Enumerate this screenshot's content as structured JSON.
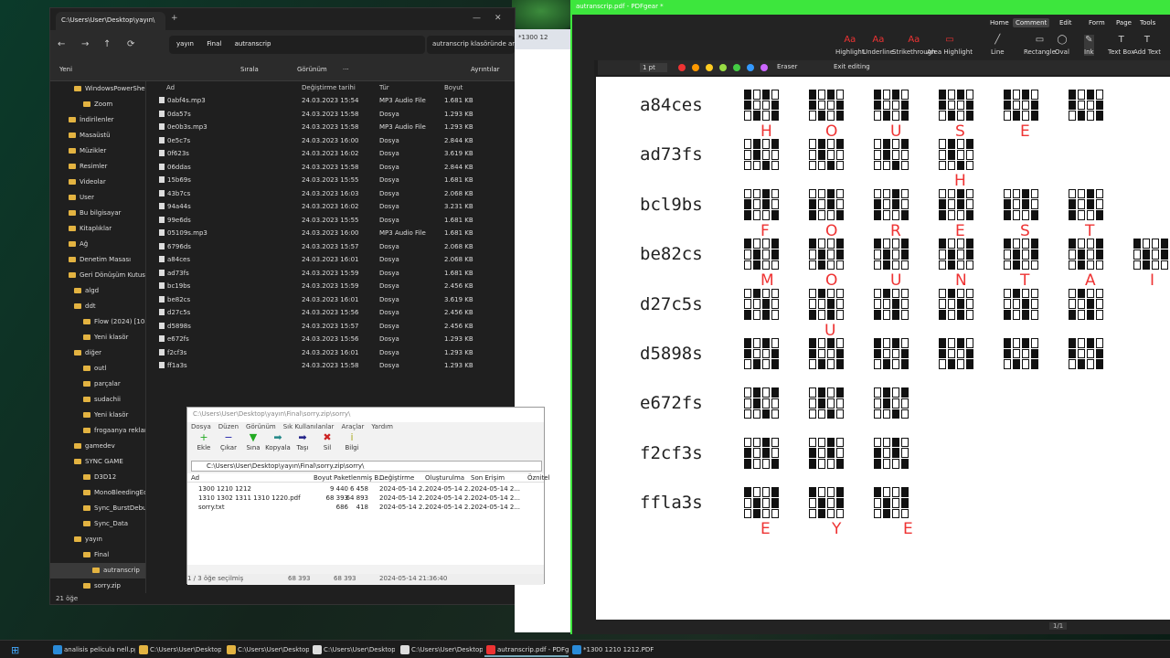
{
  "explorer": {
    "tab_title": "C:\\Users\\User\\Desktop\\yayın\\",
    "breadcrumb": [
      "yayın",
      "Final",
      "autranscrip"
    ],
    "search_placeholder": "autranscrip klasöründe ar..",
    "cmd": {
      "new": "Yeni",
      "sort": "Sırala",
      "view": "Görünüm",
      "more": "···",
      "details": "Ayrıntılar"
    },
    "columns": {
      "name": "Ad",
      "date": "Değiştirme tarihi",
      "type": "Tür",
      "size": "Boyut"
    },
    "files": [
      {
        "name": "0abf4s.mp3",
        "date": "24.03.2023 15:54",
        "type": "MP3 Audio File",
        "size": "1.681 KB"
      },
      {
        "name": "0da57s",
        "date": "24.03.2023 15:58",
        "type": "Dosya",
        "size": "1.293 KB"
      },
      {
        "name": "0e0b3s.mp3",
        "date": "24.03.2023 15:58",
        "type": "MP3 Audio File",
        "size": "1.293 KB"
      },
      {
        "name": "0e5c7s",
        "date": "24.03.2023 16:00",
        "type": "Dosya",
        "size": "2.844 KB"
      },
      {
        "name": "0f623s",
        "date": "24.03.2023 16:02",
        "type": "Dosya",
        "size": "3.619 KB"
      },
      {
        "name": "06ddas",
        "date": "24.03.2023 15:58",
        "type": "Dosya",
        "size": "2.844 KB"
      },
      {
        "name": "15b69s",
        "date": "24.03.2023 15:55",
        "type": "Dosya",
        "size": "1.681 KB"
      },
      {
        "name": "43b7cs",
        "date": "24.03.2023 16:03",
        "type": "Dosya",
        "size": "2.068 KB"
      },
      {
        "name": "94a44s",
        "date": "24.03.2023 16:02",
        "type": "Dosya",
        "size": "3.231 KB"
      },
      {
        "name": "99e6ds",
        "date": "24.03.2023 15:55",
        "type": "Dosya",
        "size": "1.681 KB"
      },
      {
        "name": "05109s.mp3",
        "date": "24.03.2023 16:00",
        "type": "MP3 Audio File",
        "size": "1.681 KB"
      },
      {
        "name": "6796ds",
        "date": "24.03.2023 15:57",
        "type": "Dosya",
        "size": "2.068 KB"
      },
      {
        "name": "a84ces",
        "date": "24.03.2023 16:01",
        "type": "Dosya",
        "size": "2.068 KB"
      },
      {
        "name": "ad73fs",
        "date": "24.03.2023 15:59",
        "type": "Dosya",
        "size": "1.681 KB"
      },
      {
        "name": "bc19bs",
        "date": "24.03.2023 15:59",
        "type": "Dosya",
        "size": "2.456 KB"
      },
      {
        "name": "be82cs",
        "date": "24.03.2023 16:01",
        "type": "Dosya",
        "size": "3.619 KB"
      },
      {
        "name": "d27c5s",
        "date": "24.03.2023 15:56",
        "type": "Dosya",
        "size": "2.456 KB"
      },
      {
        "name": "d5898s",
        "date": "24.03.2023 15:57",
        "type": "Dosya",
        "size": "2.456 KB"
      },
      {
        "name": "e672fs",
        "date": "24.03.2023 15:56",
        "type": "Dosya",
        "size": "1.293 KB"
      },
      {
        "name": "f2cf3s",
        "date": "24.03.2023 16:01",
        "type": "Dosya",
        "size": "1.293 KB"
      },
      {
        "name": "ff1a3s",
        "date": "24.03.2023 15:58",
        "type": "Dosya",
        "size": "1.293 KB"
      }
    ],
    "nav": [
      "WindowsPowerShell",
      "Zoom",
      "İndirilenler",
      "Masaüstü",
      "Müzikler",
      "Resimler",
      "Videolar",
      "User",
      "Bu bilgisayar",
      "Kitaplıklar",
      "Ağ",
      "Denetim Masası",
      "Geri Dönüşüm Kutusu",
      "algd",
      "ddt",
      "Flow (2024) [1080p] [B",
      "Yeni klasör",
      "diğer",
      "outl",
      "parçalar",
      "sudachii",
      "Yeni klasör",
      "frogaanya reklamcılık",
      "gamedev",
      "SYNC GAME",
      "D3D12",
      "MonoBleedingEdge",
      "Sync_BurstDebugInforr",
      "Sync_Data",
      "yayın",
      "Final",
      "autranscrip",
      "sorry.zip",
      "sorry.txt"
    ],
    "status": "21 öğe"
  },
  "zip": {
    "title": "C:\\Users\\User\\Desktop\\yayın\\Final\\sorry.zip\\sorry\\",
    "menu": [
      "Dosya",
      "Düzen",
      "Görünüm",
      "Sık Kullanılanlar",
      "Araçlar",
      "Yardım"
    ],
    "tools": [
      {
        "label": "Ekle",
        "icon": "+",
        "color": "#2a2"
      },
      {
        "label": "Çıkar",
        "icon": "−",
        "color": "#22a"
      },
      {
        "label": "Sına",
        "icon": "▼",
        "color": "#2a2"
      },
      {
        "label": "Kopyala",
        "icon": "➡",
        "color": "#288"
      },
      {
        "label": "Taşı",
        "icon": "➡",
        "color": "#228"
      },
      {
        "label": "Sil",
        "icon": "✖",
        "color": "#c22"
      },
      {
        "label": "Bilgi",
        "icon": "i",
        "color": "#aa2"
      }
    ],
    "path": "C:\\Users\\User\\Desktop\\yayın\\Final\\sorry.zip\\sorry\\",
    "columns": [
      "Ad",
      "Boyut",
      "Paketlenmiş B...",
      "Değiştirme",
      "Oluşturulma",
      "Son Erişim",
      "Öznitel"
    ],
    "rows": [
      {
        "name": "1300 1210 1212",
        "size": "9 440",
        "packed": "6 458",
        "mod": "2024-05-14 2...",
        "created": "2024-05-14 2...",
        "access": "2024-05-14 2..."
      },
      {
        "name": "1310 1302 1311 1310 1220.pdf",
        "size": "68 393",
        "packed": "64 893",
        "mod": "2024-05-14 2...",
        "created": "2024-05-14 2...",
        "access": "2024-05-14 2..."
      },
      {
        "name": "sorry.txt",
        "size": "686",
        "packed": "418",
        "mod": "2024-05-14 2...",
        "created": "2024-05-14 2...",
        "access": "2024-05-14 2..."
      }
    ],
    "status": [
      "1 / 3 öğe seçilmiş",
      "68 393",
      "68 393",
      "2024-05-14 21:36:40"
    ]
  },
  "browser": {
    "tab": "*1300 12"
  },
  "pdf": {
    "title": "autranscrip.pdf - PDFgear *",
    "tabs": [
      "Home",
      "Comment",
      "Edit",
      "Form",
      "Page",
      "Tools",
      "He"
    ],
    "tools": [
      "Highlight",
      "Underline",
      "Strikethrough",
      "Area Highlight",
      "Line",
      "Rectangle",
      "Oval",
      "Ink",
      "Text Box",
      "Add Text"
    ],
    "ink": {
      "width": "1 pt",
      "eraser": "Eraser",
      "exit": "Exit editing"
    },
    "colors": [
      "#e33",
      "#f90",
      "#fc2",
      "#9d4",
      "#4c4",
      "#39f",
      "#c6f"
    ],
    "page": "1/1",
    "entries": [
      {
        "label": "a84ces",
        "n": 6
      },
      {
        "label": "ad73fs",
        "n": 4
      },
      {
        "label": "bcl9bs",
        "n": 6
      },
      {
        "label": "be82cs",
        "n": 7
      },
      {
        "label": "d27c5s",
        "n": 6
      },
      {
        "label": "d5898s",
        "n": 6
      },
      {
        "label": "e672fs",
        "n": 3
      },
      {
        "label": "f2cf3s",
        "n": 3
      },
      {
        "label": "ffla3s",
        "n": 3
      }
    ],
    "notes": {
      "r0": [
        "H",
        "O",
        "U",
        "S",
        "E"
      ],
      "r1": [
        "H"
      ],
      "r2": [
        "F",
        "O",
        "R",
        "E",
        "S",
        "T"
      ],
      "r3": [
        "M",
        "O",
        "U",
        "N",
        "T",
        "A",
        "I"
      ],
      "r4": [
        "U"
      ],
      "r8": [
        "E",
        "Y",
        "E"
      ]
    }
  },
  "taskbar": [
    {
      "label": "analisis pelicula nell.ppt",
      "color": "#2a8bd8"
    },
    {
      "label": "C:\\Users\\User\\Desktop\\",
      "color": "#e3b341"
    },
    {
      "label": "C:\\Users\\User\\Desktop\\",
      "color": "#e3b341"
    },
    {
      "label": "C:\\Users\\User\\Desktop\\",
      "color": "#ddd"
    },
    {
      "label": "C:\\Users\\User\\Desktop\\",
      "color": "#ddd"
    },
    {
      "label": "autranscrip.pdf - PDFge",
      "color": "#e33"
    },
    {
      "label": "*1300 1210 1212.PDF ve c",
      "color": "#2a8bd8"
    }
  ]
}
